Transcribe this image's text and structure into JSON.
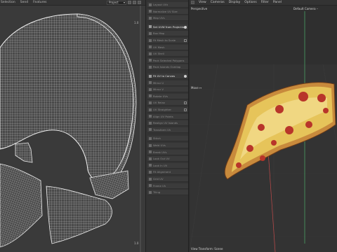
{
  "uv_editor": {
    "menu": [
      "Selection",
      "Send",
      "Features"
    ],
    "project_select": "Project",
    "corner_top_right": "1.0",
    "corner_bottom_right": "1.0"
  },
  "operator_panel": {
    "items": [
      {
        "label": "Layout UVs",
        "bright": false,
        "badge": "none"
      },
      {
        "label": "Normalize UV Size",
        "bright": false,
        "badge": "none"
      },
      {
        "label": "Map UVs",
        "bright": false,
        "badge": "none"
      },
      {
        "label": "Set UVW from Projection",
        "bright": true,
        "badge": "info"
      },
      {
        "label": "Box Map",
        "bright": false,
        "badge": "none"
      },
      {
        "label": "Fit Mesh to Scale",
        "bright": false,
        "badge": "gear"
      },
      {
        "label": "UV Mesh",
        "bright": false,
        "badge": "none"
      },
      {
        "label": "UV Shell",
        "bright": false,
        "badge": "none"
      },
      {
        "label": "Pack Selected Polygons",
        "bright": false,
        "badge": "none"
      },
      {
        "label": "Pack Islands Overlap",
        "bright": false,
        "badge": "none"
      },
      {
        "label": "Fit UV to Canvas",
        "bright": true,
        "badge": "info"
      },
      {
        "label": "Mirror U",
        "bright": false,
        "badge": "none"
      },
      {
        "label": "Mirror V",
        "bright": false,
        "badge": "none"
      },
      {
        "label": "Rotate UVs",
        "bright": false,
        "badge": "none"
      },
      {
        "label": "UV Relax",
        "bright": false,
        "badge": "gear"
      },
      {
        "label": "UV Straighten",
        "bright": false,
        "badge": "gear"
      },
      {
        "label": "Align UV Points",
        "bright": false,
        "badge": "none"
      },
      {
        "label": "Realign UV Islands",
        "bright": false,
        "badge": "none"
      },
      {
        "label": "Transform UV",
        "bright": false,
        "badge": "none"
      },
      {
        "label": "Stitch",
        "bright": false,
        "badge": "none"
      },
      {
        "label": "Weld UVs",
        "bright": false,
        "badge": "none"
      },
      {
        "label": "Break UVs",
        "bright": false,
        "badge": "none"
      },
      {
        "label": "Look Out UV",
        "bright": false,
        "badge": "none"
      },
      {
        "label": "Look In UV",
        "bright": false,
        "badge": "none"
      },
      {
        "label": "Fit Alignment",
        "bright": false,
        "badge": "none"
      },
      {
        "label": "Grid UV",
        "bright": false,
        "badge": "none"
      },
      {
        "label": "Frame UV",
        "bright": false,
        "badge": "none"
      },
      {
        "label": "Tiling",
        "bright": false,
        "badge": "none"
      }
    ]
  },
  "viewport": {
    "menu": [
      "View",
      "Cameras",
      "Display",
      "Options",
      "Filter",
      "Panel"
    ],
    "projection_label": "Perspective",
    "camera_label": "Default Camera ··",
    "move_label": "Move ↔",
    "footer_label": "View Transform: Scene"
  }
}
